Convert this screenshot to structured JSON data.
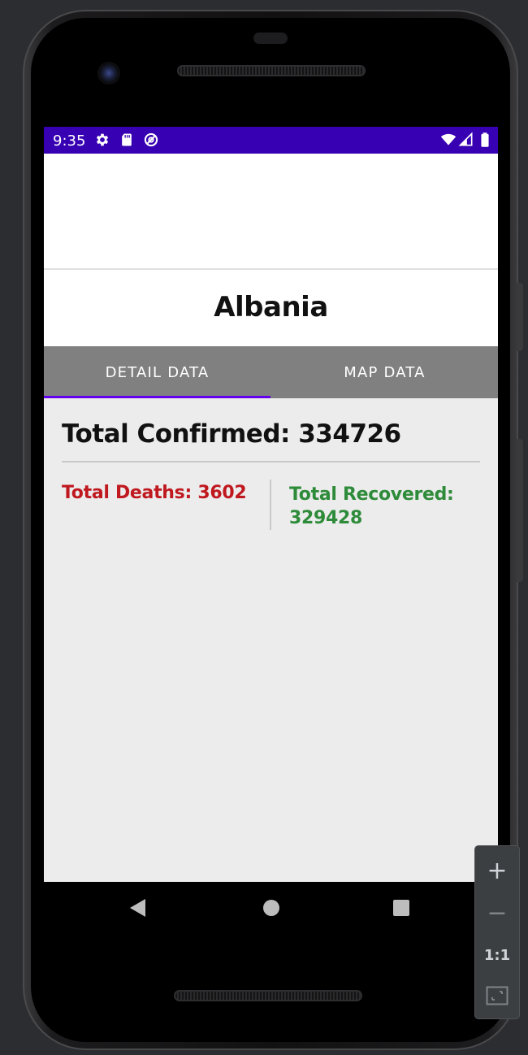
{
  "status_bar": {
    "time": "9:35",
    "left_icons": [
      "gear-icon",
      "sd-card-icon",
      "data-saver-icon"
    ],
    "right_icons": [
      "wifi-icon",
      "cell-signal-icon",
      "battery-icon"
    ],
    "color": "#3700b3"
  },
  "header": {
    "country": "Albania"
  },
  "tabs": [
    {
      "label": "DETAIL DATA",
      "selected": true
    },
    {
      "label": "MAP DATA",
      "selected": false
    }
  ],
  "stats": {
    "total_confirmed": "Total Confirmed: 334726",
    "total_deaths": "Total Deaths: 3602",
    "total_recovered": "Total Recovered: 329428"
  },
  "colors": {
    "tab_bar": "#808080",
    "tab_indicator": "#6200ee",
    "deaths": "#c0181f",
    "recovered": "#2e8b3a",
    "content_bg": "#ececec"
  },
  "emulator_controls": {
    "zoom_in": "+",
    "zoom_out": "−",
    "actual_size": "1:1"
  }
}
